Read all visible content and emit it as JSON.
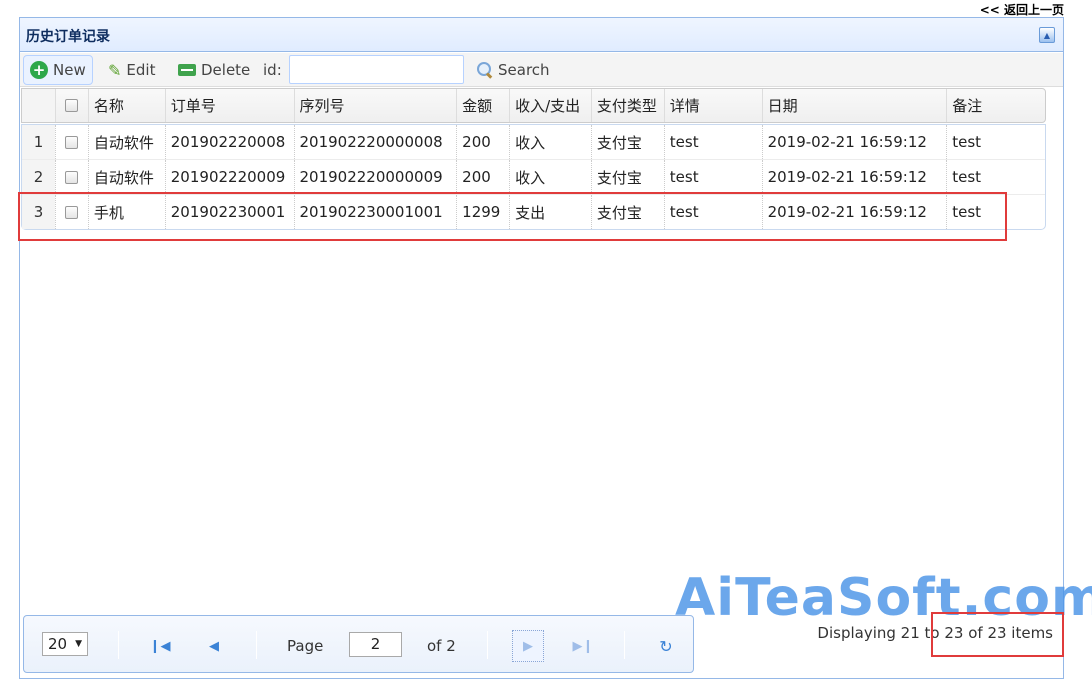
{
  "nav": {
    "back_label": "<< 返回上一页"
  },
  "panel": {
    "title": "历史订单记录"
  },
  "toolbar": {
    "new_label": "New",
    "edit_label": "Edit",
    "delete_label": "Delete",
    "id_label": "id:",
    "id_value": "",
    "search_label": "Search"
  },
  "grid": {
    "columns": [
      "名称",
      "订单号",
      "序列号",
      "金额",
      "收入/支出",
      "支付类型",
      "详情",
      "日期",
      "备注"
    ],
    "rows": [
      {
        "num": "1",
        "name": "自动软件",
        "order_no": "201902220008",
        "serial": "201902220000008",
        "amount": "200",
        "type": "收入",
        "pay": "支付宝",
        "detail": "test",
        "date": "2019-02-21 16:59:12",
        "note": "test"
      },
      {
        "num": "2",
        "name": "自动软件",
        "order_no": "201902220009",
        "serial": "201902220000009",
        "amount": "200",
        "type": "收入",
        "pay": "支付宝",
        "detail": "test",
        "date": "2019-02-21 16:59:12",
        "note": "test"
      },
      {
        "num": "3",
        "name": "手机",
        "order_no": "201902230001",
        "serial": "201902230001001",
        "amount": "1299",
        "type": "支出",
        "pay": "支付宝",
        "detail": "test",
        "date": "2019-02-21 16:59:12",
        "note": "test"
      }
    ]
  },
  "pager": {
    "page_size": "20",
    "page_label": "Page",
    "page_value": "2",
    "of_label": "of 2",
    "display_info": "Displaying 21 to 23 of 23 items"
  },
  "watermark": {
    "text": "AiTeaSoft.com"
  },
  "colors": {
    "panel_border": "#95b8e7",
    "highlight": "#e03b3b",
    "watermark": "#4a94e6"
  }
}
